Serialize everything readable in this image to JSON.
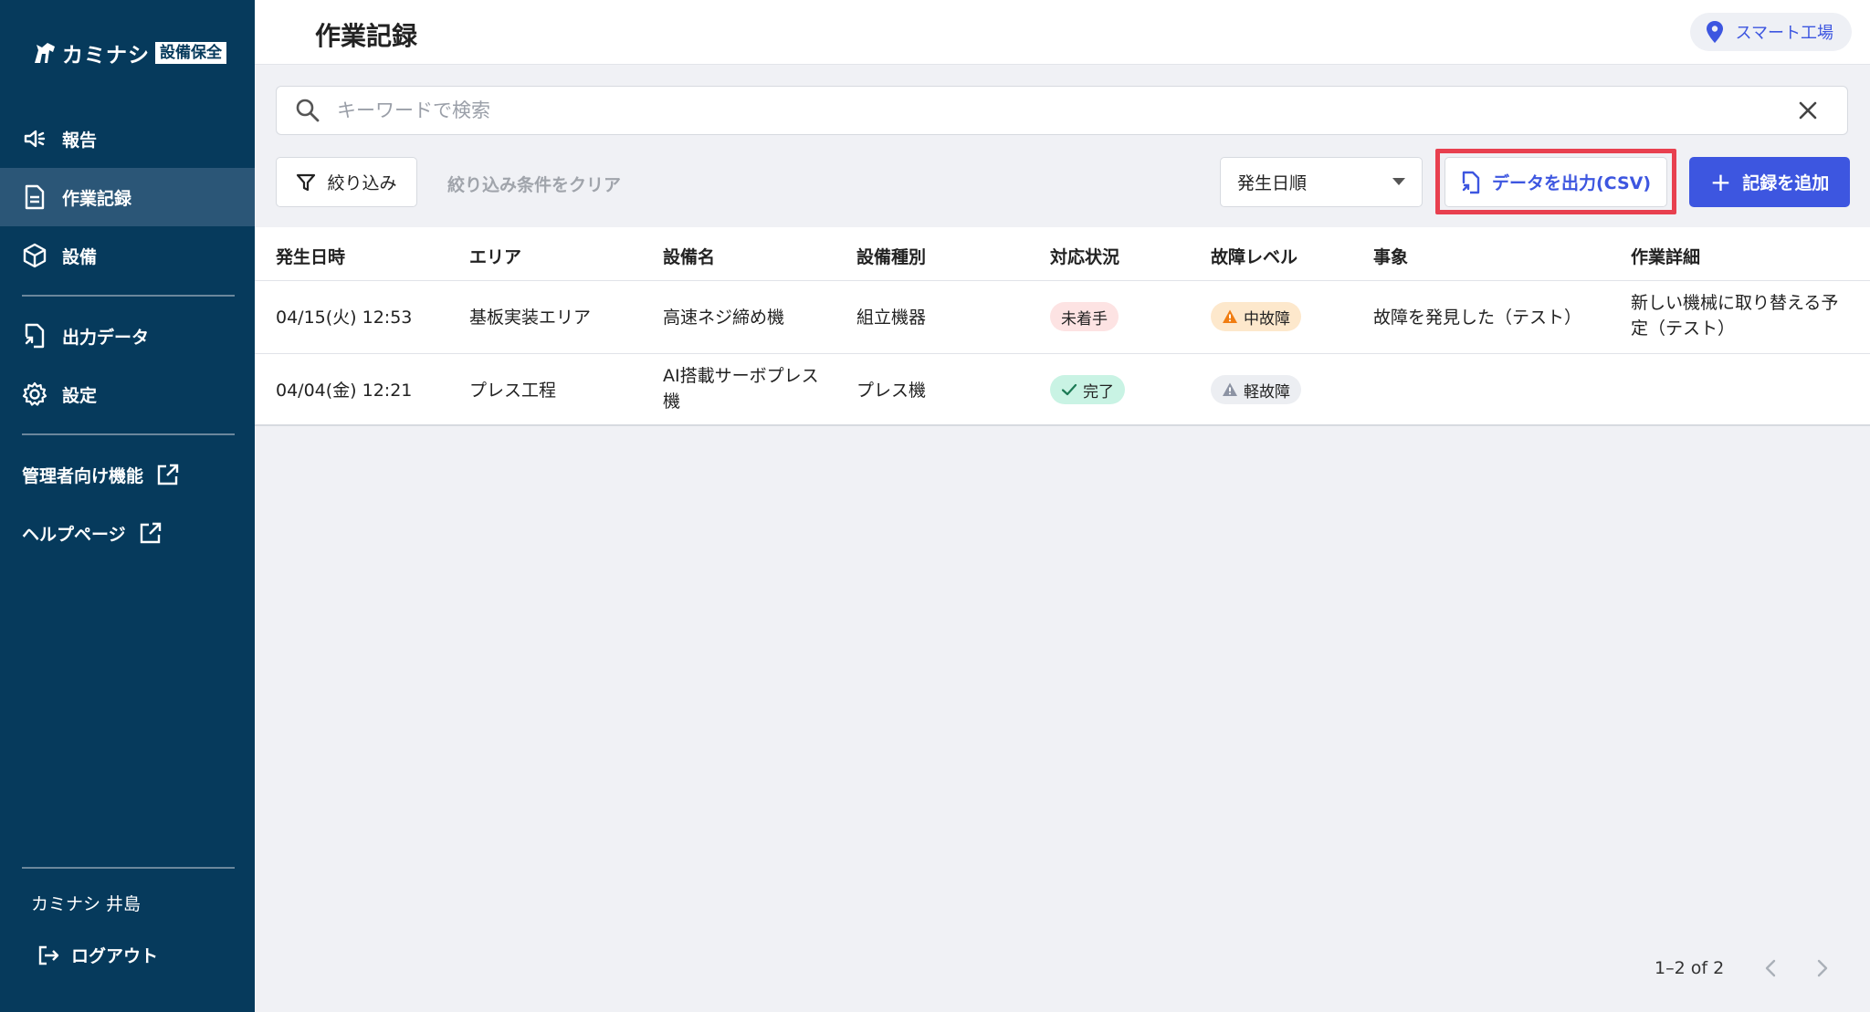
{
  "app": {
    "logo_text": "カミナシ",
    "logo_badge": "設備保全"
  },
  "sidebar": {
    "items": [
      {
        "label": "報告",
        "icon": "megaphone-icon"
      },
      {
        "label": "作業記録",
        "icon": "document-icon",
        "active": true
      },
      {
        "label": "設備",
        "icon": "cube-icon"
      },
      {
        "label": "出力データ",
        "icon": "export-file-icon"
      },
      {
        "label": "設定",
        "icon": "gear-icon"
      }
    ],
    "external": [
      {
        "label": "管理者向け機能",
        "icon": "external-link-icon"
      },
      {
        "label": "ヘルプページ",
        "icon": "external-link-icon"
      }
    ],
    "user_name": "カミナシ 井島",
    "logout_label": "ログアウト"
  },
  "header": {
    "title": "作業記録",
    "location": "スマート工場"
  },
  "search": {
    "placeholder": "キーワードで検索",
    "value": ""
  },
  "toolbar": {
    "filter_label": "絞り込み",
    "clear_filter_label": "絞り込み条件をクリア",
    "sort_value": "発生日順",
    "csv_label": "データを出力(CSV)",
    "add_label": "記録を追加"
  },
  "table": {
    "columns": [
      "発生日時",
      "エリア",
      "設備名",
      "設備種別",
      "対応状況",
      "故障レベル",
      "事象",
      "作業詳細"
    ],
    "rows": [
      {
        "datetime": "04/15(火) 12:53",
        "area": "基板実装エリア",
        "equipment": "高速ネジ締め機",
        "type": "組立機器",
        "status": "未着手",
        "level": "中故障",
        "event": "故障を発見した（テスト）",
        "detail": "新しい機械に取り替える予定（テスト）"
      },
      {
        "datetime": "04/04(金) 12:21",
        "area": "プレス工程",
        "equipment": "AI搭載サーボプレス機",
        "type": "プレス機",
        "status": "完了",
        "level": "軽故障",
        "event": "",
        "detail": ""
      }
    ]
  },
  "pagination": {
    "range": "1–2 of 2"
  },
  "colors": {
    "sidebar_bg": "#063a5c",
    "accent": "#3d56e0",
    "highlight": "#e8404f"
  }
}
